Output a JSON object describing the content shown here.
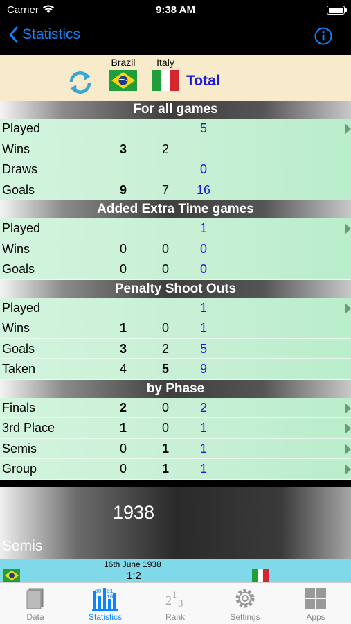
{
  "status": {
    "carrier": "Carrier",
    "time": "9:38 AM"
  },
  "nav": {
    "back_label": "Statistics"
  },
  "teams": {
    "team1": "Brazil",
    "team2": "Italy",
    "total": "Total"
  },
  "sections": [
    {
      "title": "For all games",
      "rows": [
        {
          "label": "Played",
          "b": "",
          "i": "",
          "t": "5",
          "arrow": true
        },
        {
          "label": "Wins",
          "b": "3",
          "i": "2",
          "t": "",
          "arrow": false
        },
        {
          "label": "Draws",
          "b": "",
          "i": "",
          "t": "0",
          "arrow": false
        },
        {
          "label": "Goals",
          "b": "9",
          "i": "7",
          "t": "16",
          "arrow": false
        }
      ]
    },
    {
      "title": "Added Extra Time games",
      "rows": [
        {
          "label": "Played",
          "b": "",
          "i": "",
          "t": "1",
          "arrow": true
        },
        {
          "label": "Wins",
          "b": "0",
          "i": "0",
          "t": "0",
          "arrow": false
        },
        {
          "label": "Goals",
          "b": "0",
          "i": "0",
          "t": "0",
          "arrow": false
        }
      ]
    },
    {
      "title": "Penalty Shoot Outs",
      "rows": [
        {
          "label": "Played",
          "b": "",
          "i": "",
          "t": "1",
          "arrow": true
        },
        {
          "label": "Wins",
          "b": "1",
          "i": "0",
          "t": "1",
          "arrow": false
        },
        {
          "label": "Goals",
          "b": "3",
          "i": "2",
          "t": "5",
          "arrow": false
        },
        {
          "label": "Taken",
          "b": "4",
          "i": "5",
          "t": "9",
          "arrow": false
        }
      ]
    },
    {
      "title": "by Phase",
      "rows": [
        {
          "label": "Finals",
          "b": "2",
          "i": "0",
          "t": "2",
          "arrow": true
        },
        {
          "label": "3rd Place",
          "b": "1",
          "i": "0",
          "t": "1",
          "arrow": true
        },
        {
          "label": "Semis",
          "b": "0",
          "i": "1",
          "t": "1",
          "arrow": true
        },
        {
          "label": "Group",
          "b": "0",
          "i": "1",
          "t": "1",
          "arrow": true
        }
      ]
    }
  ],
  "detail": {
    "year": "1938",
    "phase": "Semis",
    "match_date": "16th June 1938",
    "match_score": "1:2"
  },
  "tabs": [
    {
      "label": "Data",
      "icon": "data-icon"
    },
    {
      "label": "Statistics",
      "icon": "statistics-icon"
    },
    {
      "label": "Rank",
      "icon": "rank-icon"
    },
    {
      "label": "Settings",
      "icon": "gear-icon"
    },
    {
      "label": "Apps",
      "icon": "apps-icon"
    }
  ],
  "colors": {
    "accent": "#0a84ff",
    "total": "#1b1bd6",
    "row": "#c6efd4",
    "match": "#7fd9e8"
  }
}
